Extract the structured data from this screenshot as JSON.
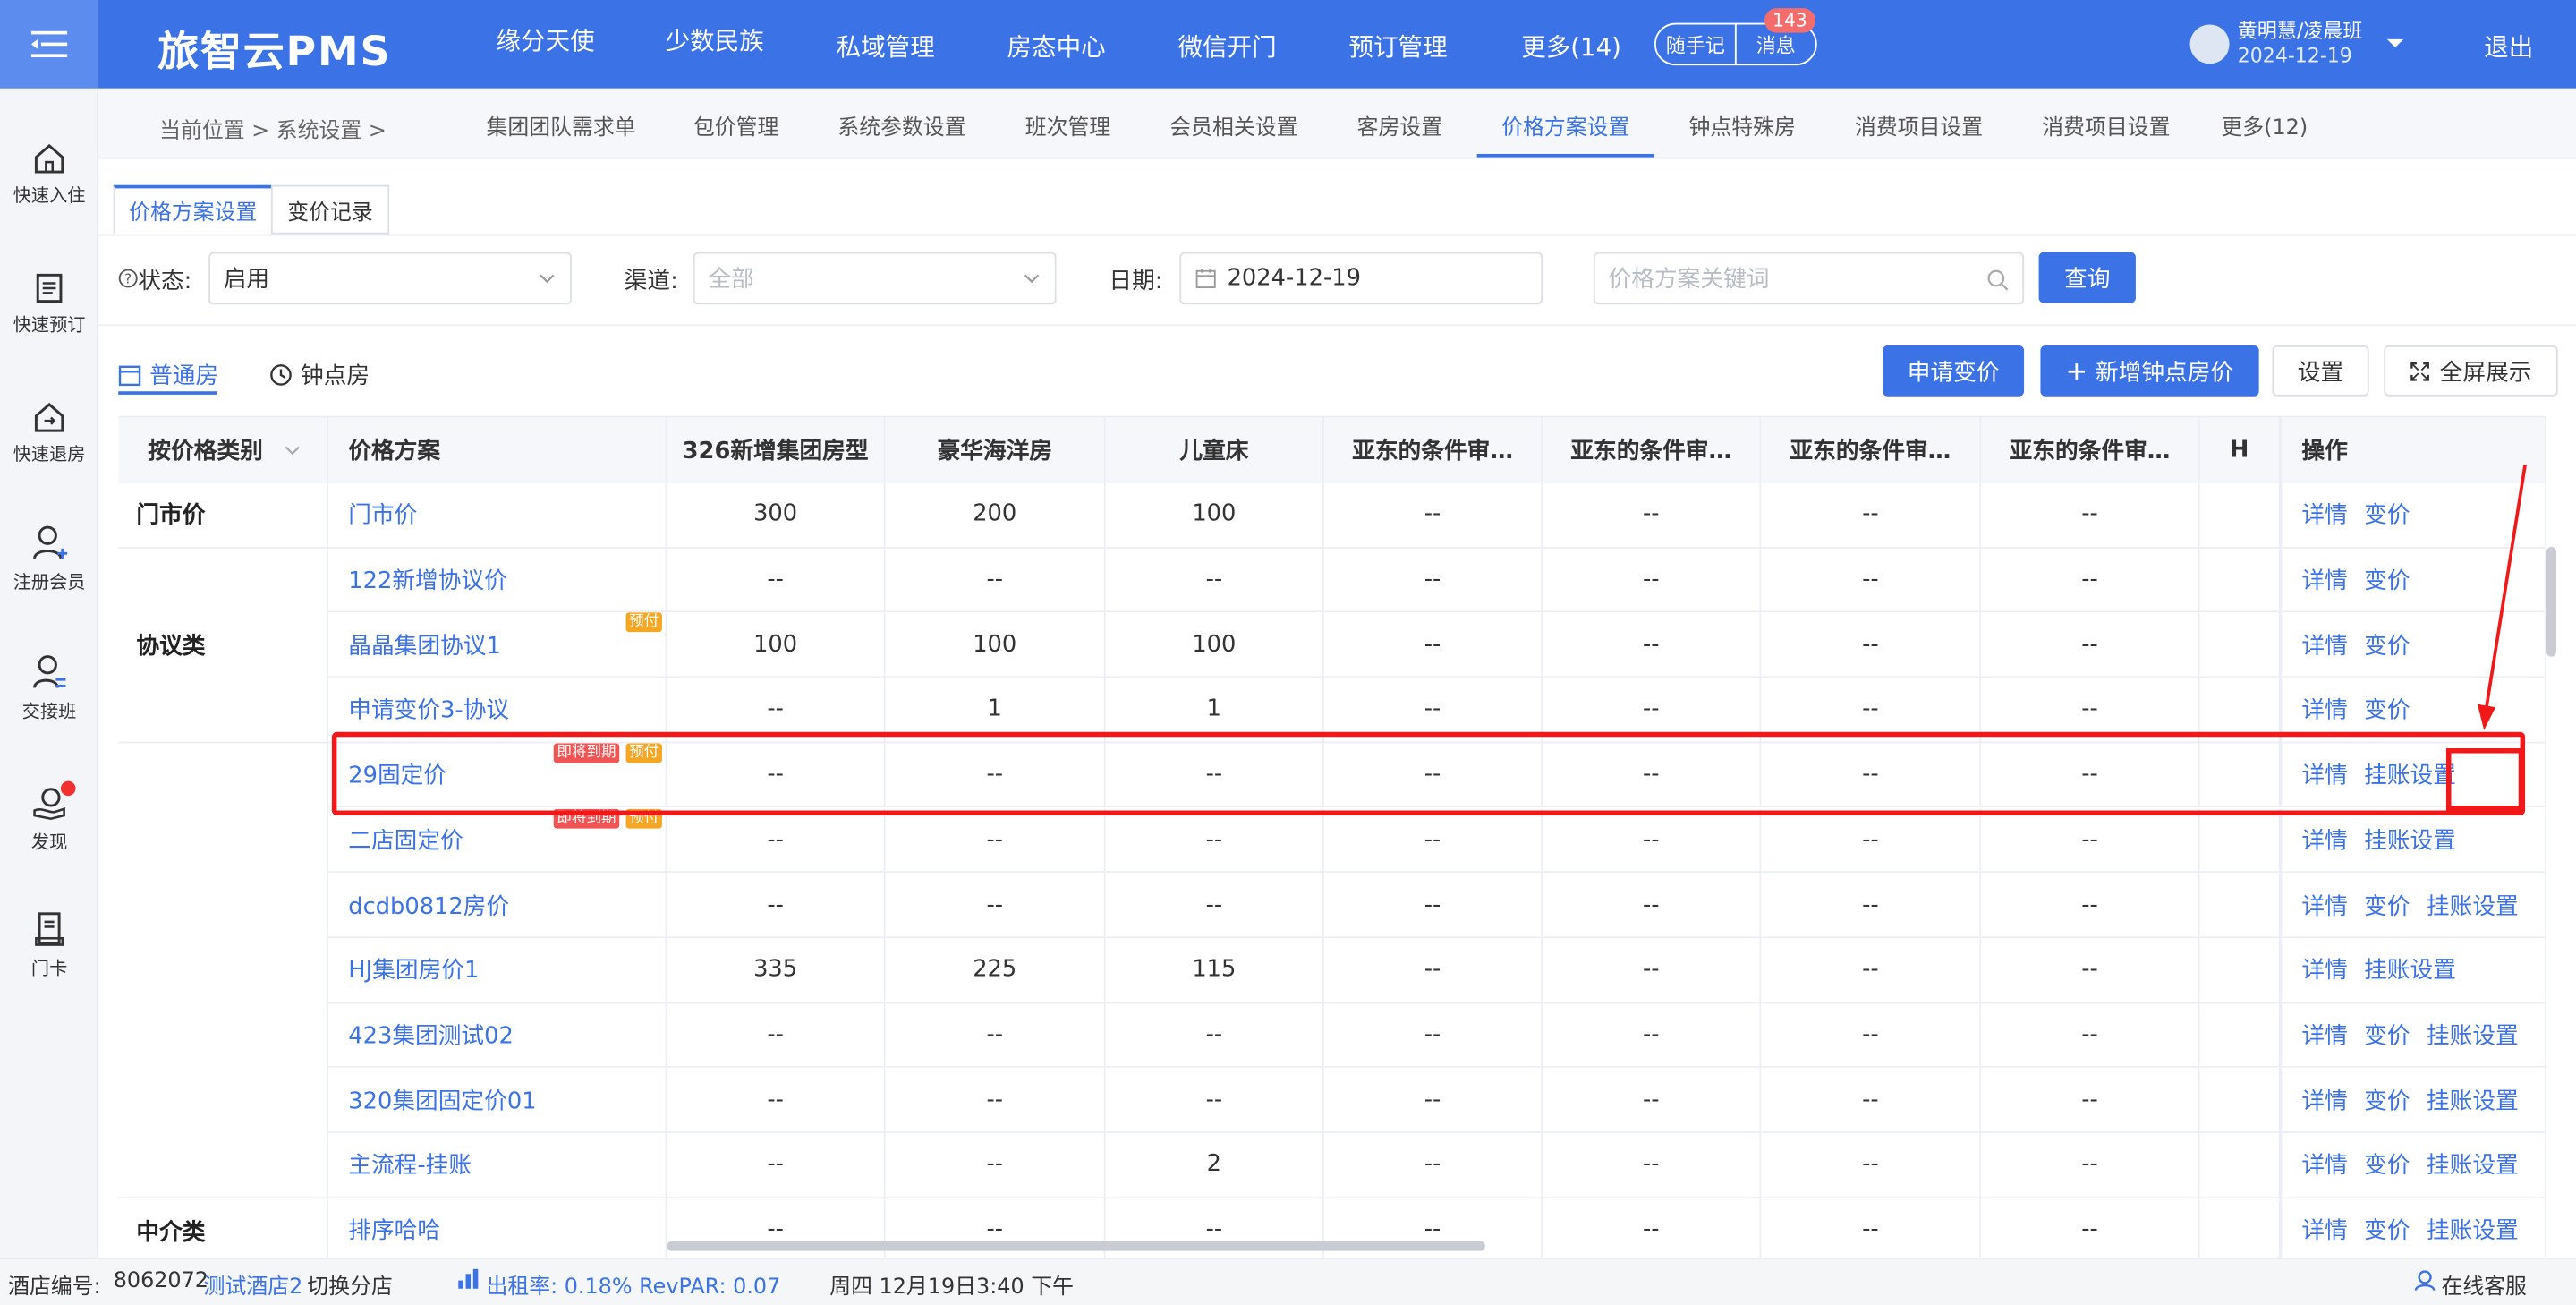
{
  "header": {
    "logo": "旅智云PMS",
    "nav": [
      "缘分天使",
      "少数民族",
      "私域管理",
      "房态中心",
      "微信开门",
      "预订管理",
      "更多(14)"
    ],
    "note_btn": "随手记",
    "msg_btn": "消息",
    "msg_badge": "143",
    "user_name": "黄明慧/凌晨班",
    "user_date": "2024-12-19",
    "logout": "退出"
  },
  "sidebar": {
    "items": [
      "快速入住",
      "快速预订",
      "快速退房",
      "注册会员",
      "交接班",
      "发现",
      "门卡"
    ]
  },
  "breadcrumb": {
    "text": "当前位置 > 系统设置 >"
  },
  "top_tabs": [
    "集团团队需求单",
    "包价管理",
    "系统参数设置",
    "班次管理",
    "会员相关设置",
    "客房设置",
    "价格方案设置",
    "钟点特殊房",
    "消费项目设置",
    "消费项目设置",
    "更多(12)"
  ],
  "sub_tabs": [
    "价格方案设置",
    "变价记录"
  ],
  "filters": {
    "status_label": "状态:",
    "status_value": "启用",
    "channel_label": "渠道:",
    "channel_placeholder": "全部",
    "date_label": "日期:",
    "date_value": "2024-12-19",
    "keyword_placeholder": "价格方案关键词",
    "query": "查询"
  },
  "room_tabs": [
    "普通房",
    "钟点房"
  ],
  "actions": {
    "apply_change": "申请变价",
    "add_hourly": "新增钟点房价",
    "settings": "设置",
    "fullscreen": "全屏展示"
  },
  "table": {
    "headers": [
      "按价格类别",
      "价格方案",
      "326新增集团房型",
      "豪华海洋房",
      "儿童床",
      "亚东的条件审…",
      "亚东的条件审…",
      "亚东的条件审…",
      "亚东的条件审…",
      "H",
      "操作"
    ],
    "groups": [
      {
        "name": "门市价",
        "rows": 1
      },
      {
        "name": "协议类",
        "rows": 3
      },
      {
        "name": "",
        "rows": 7
      },
      {
        "name": "中介类",
        "rows": 1
      }
    ],
    "rows": [
      {
        "name": "门市价",
        "tags": [],
        "vals": [
          "300",
          "200",
          "100",
          "--",
          "--",
          "--",
          "--"
        ],
        "ops": [
          "详情",
          "变价"
        ]
      },
      {
        "name": "122新增协议价",
        "tags": [],
        "vals": [
          "--",
          "--",
          "--",
          "--",
          "--",
          "--",
          "--"
        ],
        "ops": [
          "详情",
          "变价"
        ]
      },
      {
        "name": "晶晶集团协议1",
        "tags": [
          {
            "t": "预付",
            "c": "o"
          }
        ],
        "vals": [
          "100",
          "100",
          "100",
          "--",
          "--",
          "--",
          "--"
        ],
        "ops": [
          "详情",
          "变价"
        ]
      },
      {
        "name": "申请变价3-协议",
        "tags": [],
        "vals": [
          "--",
          "1",
          "1",
          "--",
          "--",
          "--",
          "--"
        ],
        "ops": [
          "详情",
          "变价"
        ]
      },
      {
        "name": "29固定价",
        "tags": [
          {
            "t": "即将到期",
            "c": "r"
          },
          {
            "t": "预付",
            "c": "o"
          }
        ],
        "vals": [
          "--",
          "--",
          "--",
          "--",
          "--",
          "--",
          "--"
        ],
        "ops": [
          "详情",
          "挂账设置"
        ]
      },
      {
        "name": "二店固定价",
        "tags": [
          {
            "t": "即将到期",
            "c": "r"
          },
          {
            "t": "预付",
            "c": "o"
          }
        ],
        "vals": [
          "--",
          "--",
          "--",
          "--",
          "--",
          "--",
          "--"
        ],
        "ops": [
          "详情",
          "挂账设置"
        ]
      },
      {
        "name": "dcdb0812房价",
        "tags": [],
        "vals": [
          "--",
          "--",
          "--",
          "--",
          "--",
          "--",
          "--"
        ],
        "ops": [
          "详情",
          "变价",
          "挂账设置"
        ]
      },
      {
        "name": "HJ集团房价1",
        "tags": [],
        "vals": [
          "335",
          "225",
          "115",
          "--",
          "--",
          "--",
          "--"
        ],
        "ops": [
          "详情",
          "挂账设置"
        ]
      },
      {
        "name": "423集团测试02",
        "tags": [],
        "vals": [
          "--",
          "--",
          "--",
          "--",
          "--",
          "--",
          "--"
        ],
        "ops": [
          "详情",
          "变价",
          "挂账设置"
        ]
      },
      {
        "name": "320集团固定价01",
        "tags": [],
        "vals": [
          "--",
          "--",
          "--",
          "--",
          "--",
          "--",
          "--"
        ],
        "ops": [
          "详情",
          "变价",
          "挂账设置"
        ]
      },
      {
        "name": "主流程-挂账",
        "tags": [],
        "vals": [
          "--",
          "--",
          "2",
          "--",
          "--",
          "--",
          "--"
        ],
        "ops": [
          "详情",
          "变价",
          "挂账设置"
        ]
      },
      {
        "name": "排序哈哈",
        "tags": [],
        "vals": [
          "--",
          "--",
          "--",
          "--",
          "--",
          "--",
          "--"
        ],
        "ops": [
          "详情",
          "变价",
          "挂账设置"
        ]
      }
    ]
  },
  "status_bar": {
    "hotel_label": "酒店编号:",
    "hotel_no": "8062072",
    "hotel_name": "测试酒店2",
    "switch": "切换分店",
    "occupancy": "出租率: 0.18% RevPAR: 0.07",
    "datetime": "周四 12月19日3:40 下午",
    "service": "在线客服"
  }
}
